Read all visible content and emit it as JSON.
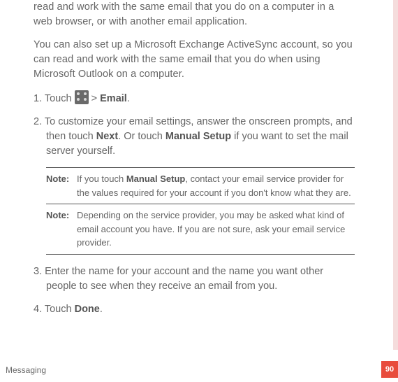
{
  "intro": {
    "p1": "read and work with the same email that you do on a computer in a web browser, or with another email application.",
    "p2": "You can also set up a Microsoft Exchange ActiveSync account, so you can read and work with the same email that you do when using Microsoft Outlook on a computer."
  },
  "steps": {
    "s1_prefix": "1. Touch ",
    "s1_sep": " > ",
    "s1_bold": "Email",
    "s1_suffix": ".",
    "s2_prefix": "2. To customize your email settings, answer the onscreen prompts, and then touch ",
    "s2_b1": "Next",
    "s2_mid": ". Or touch ",
    "s2_b2": "Manual Setup",
    "s2_suffix": " if you want to set the mail server yourself.",
    "s3": "3. Enter the name for your account and the name you want other people to see when they receive an email from you.",
    "s4_prefix": "4. Touch ",
    "s4_bold": "Done",
    "s4_suffix": "."
  },
  "notes": {
    "label": "Note:",
    "n1_a": "If you touch ",
    "n1_b": "Manual Setup",
    "n1_c": ", contact your email service provider for the values required for your account if you don't know what they are.",
    "n2": "Depending on the service provider, you may be asked what kind of email account you have. If you are not sure, ask your email service provider."
  },
  "footer": {
    "section": "Messaging",
    "page": "90"
  },
  "icons": {
    "apps": "apps-grid-icon"
  }
}
